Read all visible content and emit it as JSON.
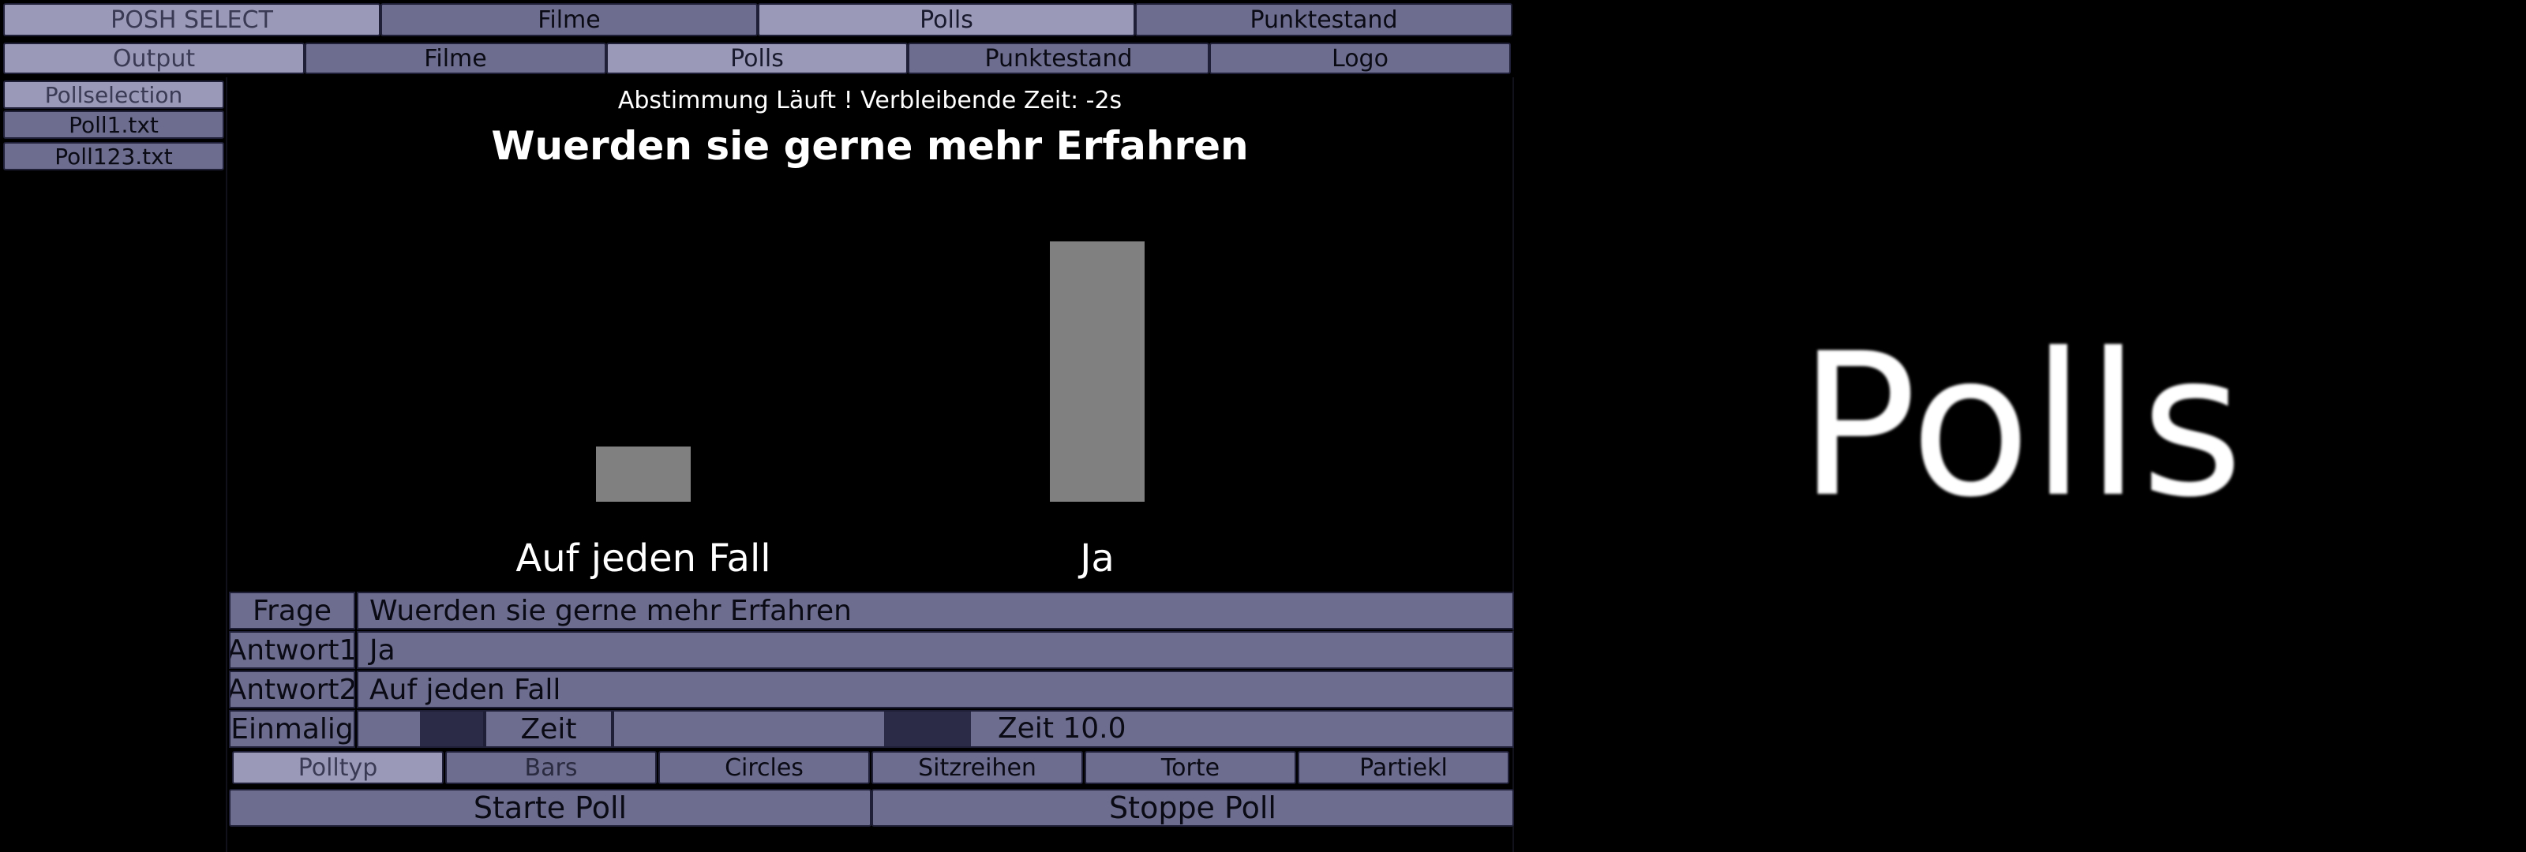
{
  "top_nav": [
    "POSH SELECT",
    "Filme",
    "Polls",
    "Punktestand"
  ],
  "second_nav": [
    "Output",
    "Filme",
    "Polls",
    "Punktestand",
    "Logo"
  ],
  "sidebar": [
    "Pollselection",
    "Poll1.txt",
    "Poll123.txt"
  ],
  "poll_view": {
    "status": "Abstimmung Läuft ! Verbleibende Zeit: -2s",
    "question": "Wuerden sie gerne mehr Erfahren"
  },
  "chart_data": {
    "type": "bar",
    "categories": [
      "Auf jeden Fall",
      "Ja"
    ],
    "values": [
      1,
      4.7
    ],
    "ylim": [
      0,
      4.7
    ]
  },
  "form": {
    "frage_label": "Frage",
    "frage_value": "Wuerden sie gerne mehr Erfahren",
    "antwort1_label": "Antwort1",
    "antwort1_value": "Ja",
    "antwort2_label": "Antwort2",
    "antwort2_value": "Auf jeden Fall",
    "einmalig_label": "Einmalig",
    "zeit_label": "Zeit",
    "zeit_value": "Zeit 10.0"
  },
  "polltyp": [
    "Polltyp",
    "Bars",
    "Circles",
    "Sitzreihen",
    "Torte",
    "Partiekl"
  ],
  "actions": {
    "start": "Starte Poll",
    "stop": "Stoppe Poll"
  },
  "preview": {
    "text": "Polls"
  },
  "colors": {
    "button": "#6d6d8f",
    "button_active": "#9a9ab8",
    "bar": "#808080",
    "background": "#000000"
  }
}
